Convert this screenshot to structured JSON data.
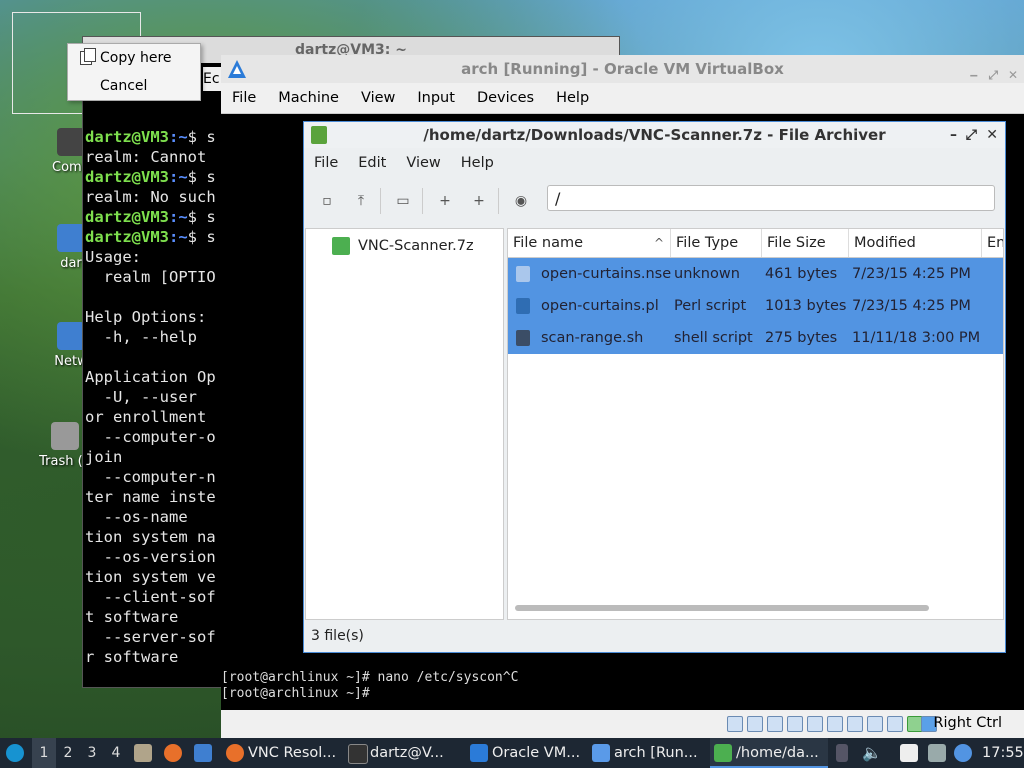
{
  "desktop": {
    "icons": [
      {
        "label": "Comp",
        "icon": "computer-icon"
      },
      {
        "label": "dar",
        "icon": "home-folder-icon"
      },
      {
        "label": "Netw",
        "icon": "network-icon"
      },
      {
        "label": "Trash (E",
        "icon": "trash-icon"
      }
    ]
  },
  "context_menu": {
    "items": [
      {
        "label": "Copy here",
        "icon": "copy-icon"
      },
      {
        "label": "Cancel"
      }
    ]
  },
  "back_terminal": {
    "title": "dartz@VM3: ~",
    "menu_fragment": "Ec",
    "prompt_user": "dartz@VM3",
    "prompt_path": ":~",
    "lines": [
      {
        "type": "prompt",
        "cmd": "$ s"
      },
      {
        "type": "text",
        "text": "realm: Cannot"
      },
      {
        "type": "prompt",
        "cmd": "$ s"
      },
      {
        "type": "text",
        "text": "realm: No such"
      },
      {
        "type": "prompt",
        "cmd": "$ s"
      },
      {
        "type": "prompt",
        "cmd": "$ s"
      },
      {
        "type": "text",
        "text": "Usage:"
      },
      {
        "type": "text",
        "text": "  realm [OPTIO"
      },
      {
        "type": "text",
        "text": ""
      },
      {
        "type": "text",
        "text": "Help Options:"
      },
      {
        "type": "text",
        "text": "  -h, --help"
      },
      {
        "type": "text",
        "text": ""
      },
      {
        "type": "text",
        "text": "Application Op"
      },
      {
        "type": "text",
        "text": "  -U, --user"
      },
      {
        "type": "text",
        "text": "or enrollment"
      },
      {
        "type": "text",
        "text": "  --computer-o"
      },
      {
        "type": "text",
        "text": "join"
      },
      {
        "type": "text",
        "text": "  --computer-n"
      },
      {
        "type": "text",
        "text": "ter name inste"
      },
      {
        "type": "text",
        "text": "  --os-name"
      },
      {
        "type": "text",
        "text": "tion system na"
      },
      {
        "type": "text",
        "text": "  --os-version"
      },
      {
        "type": "text",
        "text": "tion system ve"
      },
      {
        "type": "text",
        "text": "  --client-sof"
      },
      {
        "type": "text",
        "text": "t software"
      },
      {
        "type": "text",
        "text": "  --server-sof"
      },
      {
        "type": "text",
        "text": "r software"
      }
    ]
  },
  "vbox": {
    "title": "arch [Running] - Oracle VM VirtualBox",
    "menu": [
      "File",
      "Machine",
      "View",
      "Input",
      "Devices",
      "Help"
    ],
    "guest_terminal": [
      "[root@archlinux ~]# nano /etc/syscon^C",
      "[root@archlinux ~]# "
    ],
    "host_key": "Right Ctrl"
  },
  "archiver": {
    "title": "/home/dartz/Downloads/VNC-Scanner.7z - File Archiver",
    "menu": [
      "File",
      "Edit",
      "View",
      "Help"
    ],
    "location": "/",
    "tree_root": "VNC-Scanner.7z",
    "columns": [
      "File name",
      "File Type",
      "File Size",
      "Modified",
      "En"
    ],
    "sort_indicator": "^",
    "files": [
      {
        "name": "open-curtains.nse",
        "type": "unknown",
        "size": "461 bytes",
        "modified": "7/23/15 4:25 PM",
        "icon": "unknown-file-icon"
      },
      {
        "name": "open-curtains.pl",
        "type": "Perl script",
        "size": "1013 bytes",
        "modified": "7/23/15 4:25 PM",
        "icon": "perl-script-icon"
      },
      {
        "name": "scan-range.sh",
        "type": "shell script",
        "size": "275 bytes",
        "modified": "11/11/18 3:00 PM",
        "icon": "shell-script-icon"
      }
    ],
    "status": "3 file(s)",
    "accent": "#5294e2"
  },
  "taskbar": {
    "workspaces": [
      "1",
      "2",
      "3",
      "4"
    ],
    "active_workspace": "1",
    "tasks": [
      {
        "label": "VNC Resol...",
        "icon": "firefox-icon"
      },
      {
        "label": "dartz@V...",
        "icon": "terminal-icon"
      },
      {
        "label": "Oracle VM...",
        "icon": "virtualbox-icon"
      },
      {
        "label": "arch [Run...",
        "icon": "virtualbox-vm-icon"
      },
      {
        "label": "/home/da...",
        "icon": "archive-icon"
      }
    ],
    "clock": "17:55"
  }
}
